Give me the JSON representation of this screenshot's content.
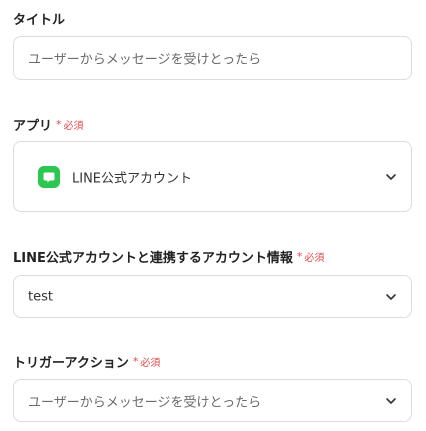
{
  "required_text": "必須",
  "required_mark": "*",
  "accent_color": "#e5484d",
  "fields": {
    "title": {
      "label": "タイトル",
      "value": "ユーザーからメッセージを受けとったら"
    },
    "app": {
      "label": "アプリ",
      "value": "LINE公式アカウント",
      "icon": "line-app-icon",
      "icon_color": "#2bc84f"
    },
    "account": {
      "label": "LINE公式アカウントと連携するアカウント情報",
      "value": "test"
    },
    "trigger": {
      "label": "トリガーアクション",
      "value": "ユーザーからメッセージを受けとったら"
    }
  }
}
